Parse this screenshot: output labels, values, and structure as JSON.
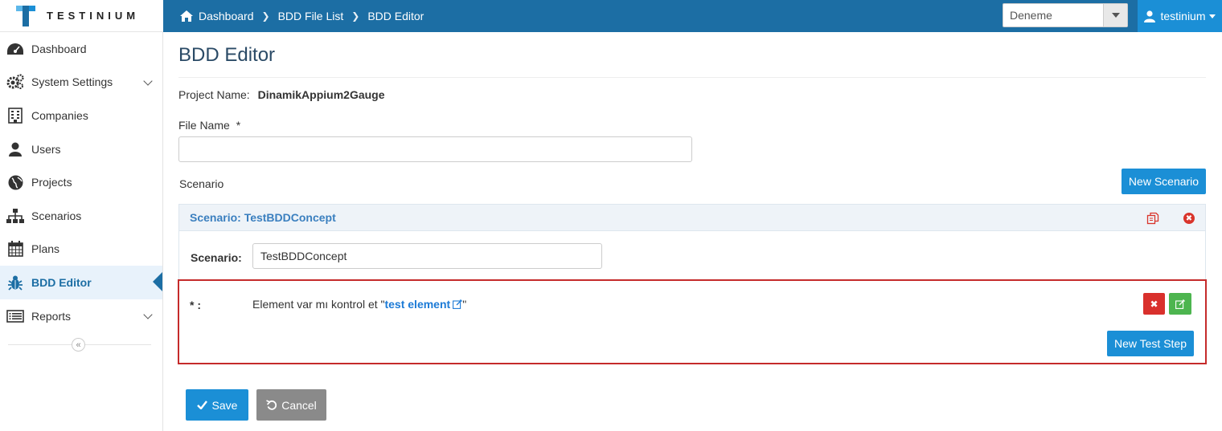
{
  "brand": {
    "name": "TESTINIUM"
  },
  "breadcrumb": {
    "items": [
      "Dashboard",
      "BDD File List",
      "BDD Editor"
    ]
  },
  "project_selector": {
    "value": "Deneme"
  },
  "user": {
    "name": "testinium"
  },
  "sidebar": {
    "items": [
      {
        "label": "Dashboard",
        "icon": "tachometer-icon"
      },
      {
        "label": "System Settings",
        "icon": "gears-icon",
        "expandable": true
      },
      {
        "label": "Companies",
        "icon": "building-icon"
      },
      {
        "label": "Users",
        "icon": "user-icon"
      },
      {
        "label": "Projects",
        "icon": "globe-icon"
      },
      {
        "label": "Scenarios",
        "icon": "sitemap-icon"
      },
      {
        "label": "Plans",
        "icon": "calendar-icon"
      },
      {
        "label": "BDD Editor",
        "icon": "bug-icon",
        "active": true
      },
      {
        "label": "Reports",
        "icon": "list-icon",
        "expandable": true
      }
    ],
    "collapse_glyph": "«"
  },
  "page": {
    "title": "BDD Editor",
    "project_name_label": "Project Name:",
    "project_name_value": "DinamikAppium2Gauge",
    "file_name_label": "File Name",
    "required_mark": "*",
    "file_name_value": "",
    "scenario_label": "Scenario",
    "new_scenario_label": "New Scenario"
  },
  "scenario_panel": {
    "heading": "Scenario: TestBDDConcept",
    "field_label": "Scenario:",
    "field_value": "TestBDDConcept"
  },
  "step": {
    "marker": "* :",
    "text_before": "Element var mı kontrol et \"",
    "element": "test element",
    "text_after": "\"",
    "delete_glyph": "✖",
    "new_step_label": "New Test Step"
  },
  "actions": {
    "save_label": "Save",
    "cancel_label": "Cancel"
  },
  "colors": {
    "topbar": "#1c6ea4",
    "primary": "#1b8fd6",
    "danger": "#d9302c",
    "success": "#4db54f",
    "highlight_border": "#c52b2b"
  }
}
